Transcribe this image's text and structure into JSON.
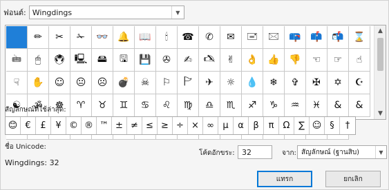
{
  "font": {
    "label": "ฟอนต์:",
    "value": "Wingdings"
  },
  "grid": {
    "symbols": [
      "",
      "✏",
      "✂",
      "✁",
      "👓",
      "🔔",
      "📖",
      "🕯",
      "☎",
      "✆",
      "✉",
      "🖃",
      "🖂",
      "📪",
      "📫",
      "📬",
      "⌛",
      "🖮",
      "🖱",
      "🖲",
      "🖳",
      "🖴",
      "🖫",
      "💾",
      "✇",
      "✍",
      "🖎",
      "✌",
      "👌",
      "👍",
      "👎",
      "☜",
      "☞",
      "☝",
      "☟",
      "✋",
      "☺",
      "😐",
      "☹",
      "💣",
      "☠",
      "⚐",
      "🏱",
      "✈",
      "☼",
      "💧",
      "❄",
      "✞",
      "✠",
      "✡",
      "☪",
      "☯",
      "ॐ",
      "☸",
      "♈",
      "♉",
      "♊",
      "♋",
      "♌",
      "♍",
      "♎",
      "♏",
      "♐",
      "♑",
      "♒",
      "♓",
      "&",
      "&",
      "●",
      "❍",
      "■",
      "□",
      "◻",
      "❑",
      "❒",
      "⬧",
      "⧫",
      "◆",
      "❖",
      "⬥",
      "⌧",
      "⍓",
      "⌘",
      "❀"
    ]
  },
  "recent": {
    "label": "สัญลักษณ์ที่ใช้ล่าสุด:",
    "symbols": [
      "😊",
      "€",
      "£",
      "¥",
      "©",
      "®",
      "™",
      "±",
      "≠",
      "≤",
      "≥",
      "÷",
      "×",
      "∞",
      "µ",
      "α",
      "β",
      "π",
      "Ω",
      "∑",
      "☺",
      "§",
      "†"
    ]
  },
  "unicode": {
    "name_label": "ชื่อ Unicode:",
    "value": "Wingdings: 32"
  },
  "charcode": {
    "label": "โค้ดอักขระ:",
    "value": "32"
  },
  "from": {
    "label": "จาก:",
    "value": "สัญลักษณ์ (ฐานสิบ)"
  },
  "buttons": {
    "insert": "แทรก",
    "cancel": "ยกเลิก"
  },
  "icons": {
    "dropdown": "chevron-down-icon",
    "scroll_up": "chevron-up-icon",
    "scroll_down": "chevron-down-icon"
  }
}
